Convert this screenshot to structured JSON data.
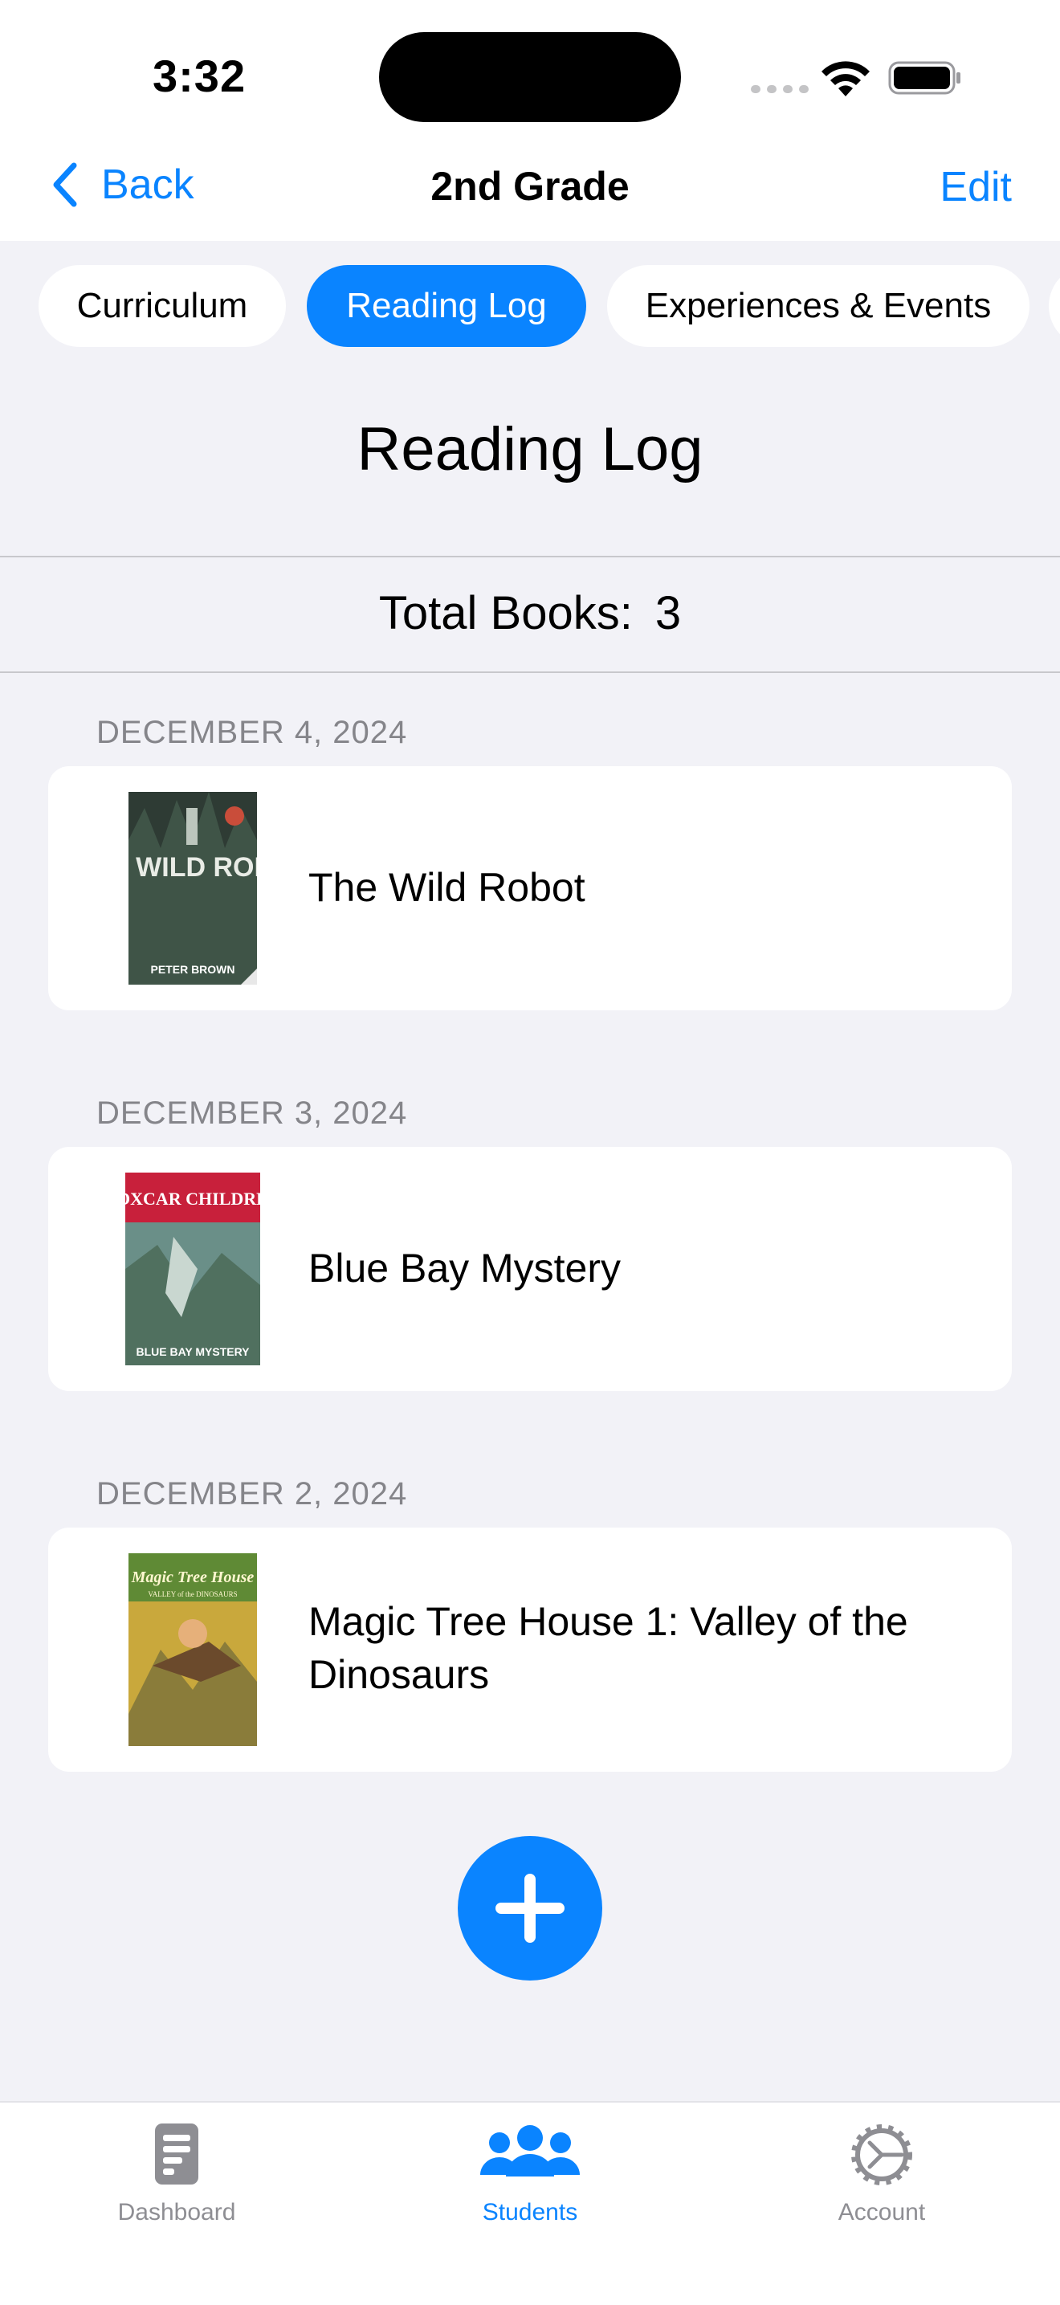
{
  "status_bar": {
    "time": "3:32"
  },
  "nav": {
    "back_label": "Back",
    "title": "2nd Grade",
    "edit_label": "Edit"
  },
  "segments": [
    {
      "label": "Curriculum",
      "active": false
    },
    {
      "label": "Reading Log",
      "active": true
    },
    {
      "label": "Experiences & Events",
      "active": false
    }
  ],
  "page": {
    "heading": "Reading Log",
    "total_label": "Total Books:",
    "total_count": "3"
  },
  "entries": [
    {
      "date": "DECEMBER 4, 2024",
      "title": "The Wild Robot",
      "cover_icon": "the-wild-robot-cover",
      "cover_text": "THE WILD ROBOT",
      "cover_author": "PETER BROWN"
    },
    {
      "date": "DECEMBER 3, 2024",
      "title": "Blue Bay Mystery",
      "cover_icon": "blue-bay-mystery-cover",
      "cover_text": "BOXCAR CHILDREN",
      "cover_author": "BLUE BAY MYSTERY"
    },
    {
      "date": "DECEMBER 2, 2024",
      "title": "Magic Tree House 1: Valley of the Dinosaurs",
      "cover_icon": "magic-tree-house-cover",
      "cover_text": "Magic Tree House",
      "cover_author": "VALLEY of the DINOSAURS"
    }
  ],
  "add_button": {
    "icon": "plus-icon"
  },
  "tab_bar": [
    {
      "label": "Dashboard",
      "icon": "dashboard-icon",
      "active": false
    },
    {
      "label": "Students",
      "icon": "students-icon",
      "active": true
    },
    {
      "label": "Account",
      "icon": "gear-icon",
      "active": false
    }
  ],
  "colors": {
    "accent": "#0a84ff",
    "background": "#f2f2f7",
    "secondary_text": "#85858a"
  }
}
